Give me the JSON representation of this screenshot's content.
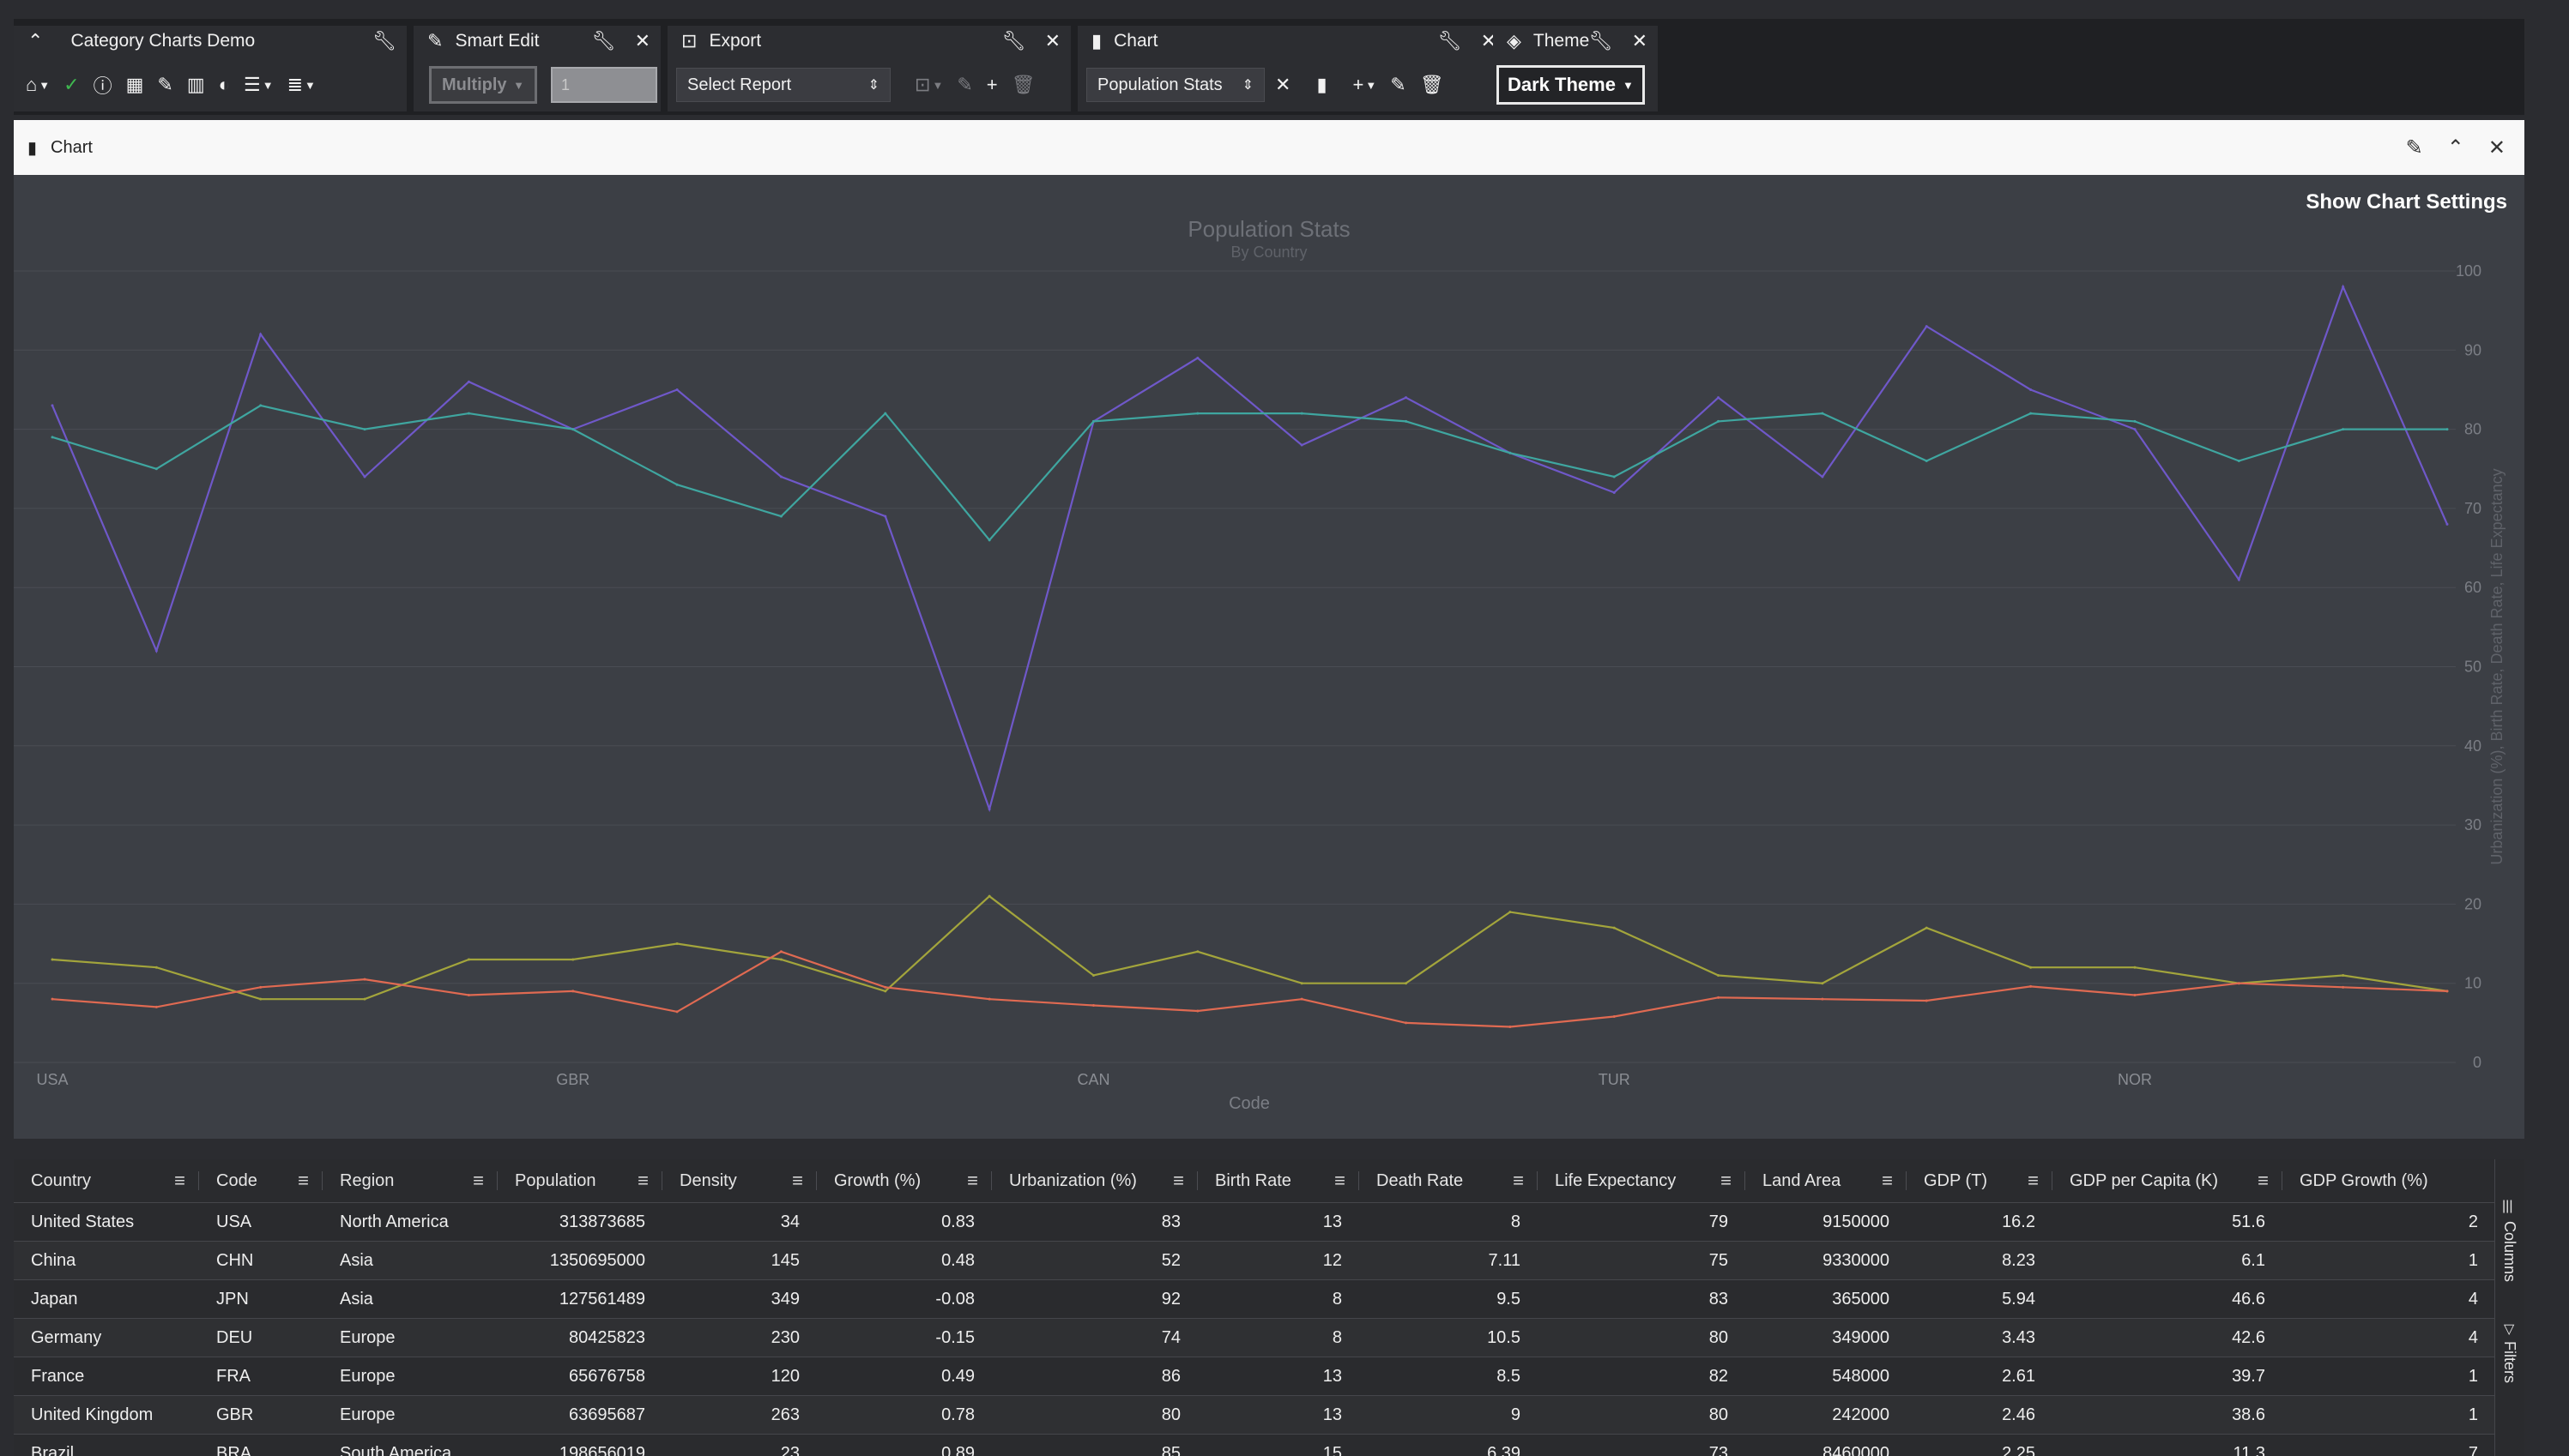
{
  "toolbar": {
    "dashboard": {
      "title": "Category Charts Demo"
    },
    "smart_edit": {
      "title": "Smart Edit",
      "operation": "Multiply",
      "value_placeholder": "1"
    },
    "export": {
      "title": "Export",
      "report_select": "Select Report"
    },
    "chart": {
      "title": "Chart",
      "chart_select": "Population Stats"
    },
    "theme": {
      "title": "Theme",
      "theme_select": "Dark Theme"
    }
  },
  "chart_panel": {
    "title": "Chart",
    "show_settings": "Show Chart Settings"
  },
  "chart_data": {
    "type": "line",
    "title": "Population Stats",
    "subtitle": "By Country",
    "xlabel": "Code",
    "ylabel": "Urbanization (%), Birth Rate, Death Rate, Life Expectancy",
    "ylim": [
      0,
      100
    ],
    "yticks": [
      0,
      10,
      20,
      30,
      40,
      50,
      60,
      70,
      80,
      90,
      100
    ],
    "x_tick_labels": [
      "USA",
      "GBR",
      "CAN",
      "TUR",
      "NOR"
    ],
    "grid": true,
    "series": [
      {
        "color": "#6f58c9",
        "values": [
          83,
          52,
          92,
          74,
          86,
          80,
          85,
          74,
          69,
          32,
          81,
          89,
          78,
          84,
          77,
          72,
          84,
          74,
          93,
          85,
          80,
          61,
          98,
          68
        ]
      },
      {
        "color": "#3fa6a0",
        "values": [
          79,
          75,
          83,
          80,
          82,
          80,
          73,
          69,
          82,
          66,
          81,
          82,
          82,
          81,
          77,
          74,
          81,
          82,
          76,
          82,
          81,
          76,
          80,
          80
        ]
      },
      {
        "color": "#a3a53c",
        "values": [
          13,
          12,
          8,
          8,
          13,
          13,
          15,
          13,
          9,
          21,
          11,
          14,
          10,
          10,
          19,
          17,
          11,
          10,
          17,
          12,
          12,
          10,
          11,
          9
        ]
      },
      {
        "color": "#e06a52",
        "values": [
          8,
          7,
          9.5,
          10.5,
          8.5,
          9,
          6.4,
          14,
          9.5,
          8,
          7.2,
          6.5,
          8,
          5,
          4.5,
          5.8,
          8.2,
          8,
          7.8,
          9.6,
          8.5,
          10,
          9.5,
          9
        ]
      }
    ]
  },
  "grid": {
    "columns": [
      "Country",
      "Code",
      "Region",
      "Population",
      "Density",
      "Growth (%)",
      "Urbanization (%)",
      "Birth Rate",
      "Death Rate",
      "Life Expectancy",
      "Land Area",
      "GDP (T)",
      "GDP per Capita (K)",
      "GDP Growth (%)"
    ],
    "rows": [
      [
        "United States",
        "USA",
        "North America",
        "313873685",
        "34",
        "0.83",
        "83",
        "13",
        "8",
        "79",
        "9150000",
        "16.2",
        "51.6",
        "2"
      ],
      [
        "China",
        "CHN",
        "Asia",
        "1350695000",
        "145",
        "0.48",
        "52",
        "12",
        "7.11",
        "75",
        "9330000",
        "8.23",
        "6.1",
        "1"
      ],
      [
        "Japan",
        "JPN",
        "Asia",
        "127561489",
        "349",
        "-0.08",
        "92",
        "8",
        "9.5",
        "83",
        "365000",
        "5.94",
        "46.6",
        "4"
      ],
      [
        "Germany",
        "DEU",
        "Europe",
        "80425823",
        "230",
        "-0.15",
        "74",
        "8",
        "10.5",
        "80",
        "349000",
        "3.43",
        "42.6",
        "4"
      ],
      [
        "France",
        "FRA",
        "Europe",
        "65676758",
        "120",
        "0.49",
        "86",
        "13",
        "8.5",
        "82",
        "548000",
        "2.61",
        "39.7",
        "1"
      ],
      [
        "United Kingdom",
        "GBR",
        "Europe",
        "63695687",
        "263",
        "0.78",
        "80",
        "13",
        "9",
        "80",
        "242000",
        "2.46",
        "38.6",
        "1"
      ],
      [
        "Brazil",
        "BRA",
        "South America",
        "198656019",
        "23",
        "0.89",
        "85",
        "15",
        "6.39",
        "73",
        "8460000",
        "2.25",
        "11.3",
        "7"
      ]
    ],
    "side_tabs": {
      "columns": "Columns",
      "filters": "Filters"
    }
  }
}
